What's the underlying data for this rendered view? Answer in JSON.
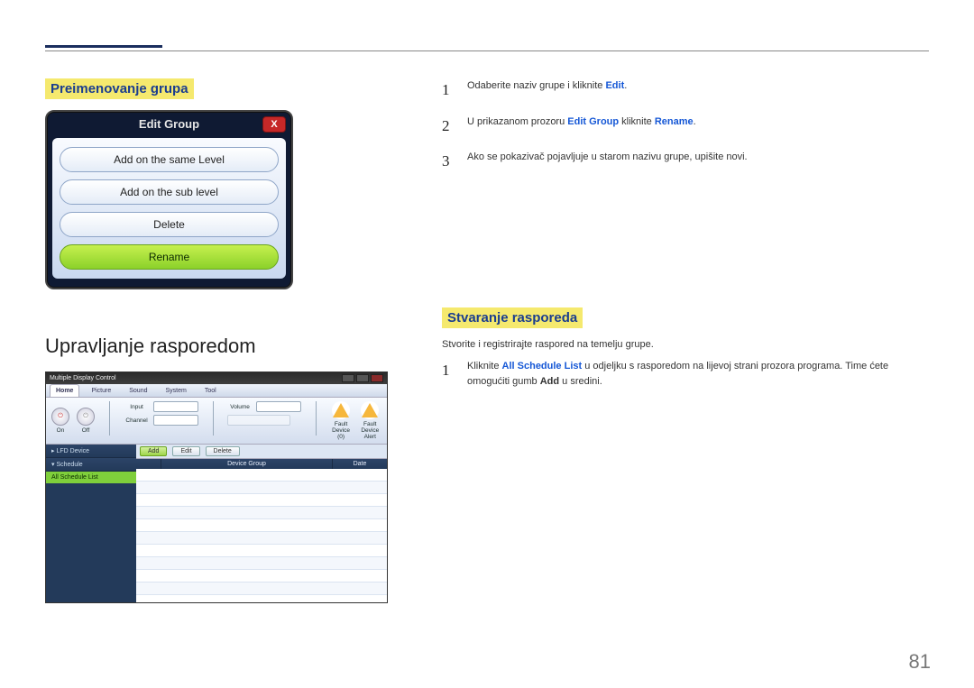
{
  "section1": {
    "title": "Preimenovanje grupa",
    "dialog": {
      "title": "Edit Group",
      "options": {
        "same": "Add on the same Level",
        "sub": "Add on the sub level",
        "del": "Delete",
        "rename": "Rename"
      }
    },
    "steps": {
      "s1a": "Odaberite naziv grupe i kliknite ",
      "s1b": "Edit",
      "s1c": ".",
      "s2a": "U prikazanom prozoru ",
      "s2b": "Edit Group",
      "s2c": " kliknite ",
      "s2d": "Rename",
      "s2e": ".",
      "s3": "Ako se pokazivač pojavljuje u starom nazivu grupe, upišite novi."
    }
  },
  "section2": {
    "heading": "Upravljanje rasporedom",
    "rightTitle": "Stvaranje rasporeda",
    "intro": "Stvorite i registrirajte raspored na temelju grupe.",
    "step1a": "Kliknite ",
    "step1b": "All Schedule List",
    "step1c": " u odjeljku s rasporedom na lijevoj strani prozora programa. Time ćete omogućiti gumb ",
    "step1d": "Add",
    "step1e": " u sredini."
  },
  "mdc": {
    "title": "Multiple Display Control",
    "tabs": {
      "home": "Home",
      "picture": "Picture",
      "sound": "Sound",
      "system": "System",
      "tool": "Tool"
    },
    "toolbar": {
      "on": "On",
      "off": "Off",
      "inputLabel": "Input",
      "channelLabel": "Channel",
      "volumeLabel": "Volume",
      "fault": "Fault Device (0)",
      "alert": "Fault Device Alert"
    },
    "side": {
      "lfd": "LFD Device",
      "schedule": "Schedule",
      "all": "All Schedule List"
    },
    "actions": {
      "add": "Add",
      "edit": "Edit",
      "del": "Delete"
    },
    "cols": {
      "c1": "",
      "c2": "Device Group",
      "c3": "Date"
    }
  },
  "pageNum": "81"
}
